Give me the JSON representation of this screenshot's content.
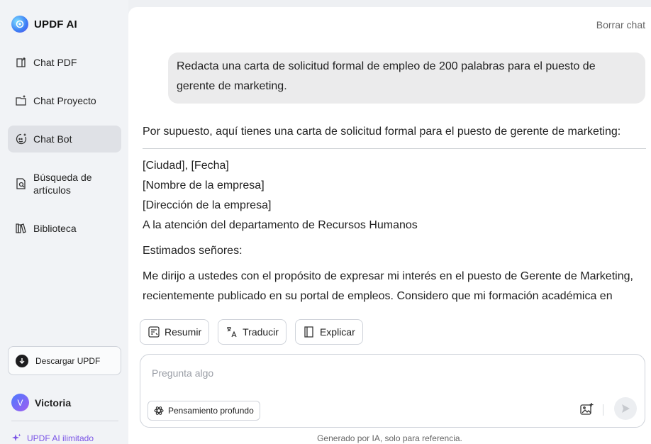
{
  "brand": {
    "name": "UPDF AI"
  },
  "sidebar": {
    "items": [
      {
        "label": "Chat PDF",
        "icon": "chat-pdf-icon"
      },
      {
        "label": "Chat Proyecto",
        "icon": "chat-project-icon"
      },
      {
        "label": "Chat Bot",
        "icon": "chat-bot-icon",
        "active": true
      },
      {
        "label": "Búsqueda de artículos",
        "icon": "article-search-icon"
      },
      {
        "label": "Biblioteca",
        "icon": "library-icon"
      }
    ],
    "download_label": "Descargar UPDF",
    "user": {
      "initial": "V",
      "name": "Victoria"
    },
    "unlimited_label": "UPDF AI ilimitado"
  },
  "header": {
    "clear_chat_label": "Borrar chat"
  },
  "chat": {
    "user_message": "Redacta una carta de solicitud formal de empleo de 200 palabras para el puesto de gerente de marketing.",
    "answer_intro": "Por supuesto, aquí tienes una carta de solicitud formal para el puesto de gerente de marketing:",
    "answer_lines": [
      "[Ciudad], [Fecha]",
      "[Nombre de la empresa]",
      "[Dirección de la empresa]",
      "A la atención del departamento de Recursos Humanos"
    ],
    "greeting": "Estimados señores:",
    "body": "Me dirijo a ustedes con el propósito de expresar mi interés en el puesto de Gerente de Marketing, recientemente publicado en su portal de empleos. Considero que mi formación académica en"
  },
  "actions": {
    "summarize": "Resumir",
    "translate": "Traducir",
    "explain": "Explicar"
  },
  "composer": {
    "placeholder": "Pregunta algo",
    "deep_thinking_label": "Pensamiento profundo"
  },
  "footer": {
    "disclaimer": "Generado por IA, solo para referencia."
  },
  "colors": {
    "accent_purple": "#7b55e6",
    "active_nav_bg": "#dfe1e6",
    "sidebar_bg": "#f1f3f6"
  }
}
